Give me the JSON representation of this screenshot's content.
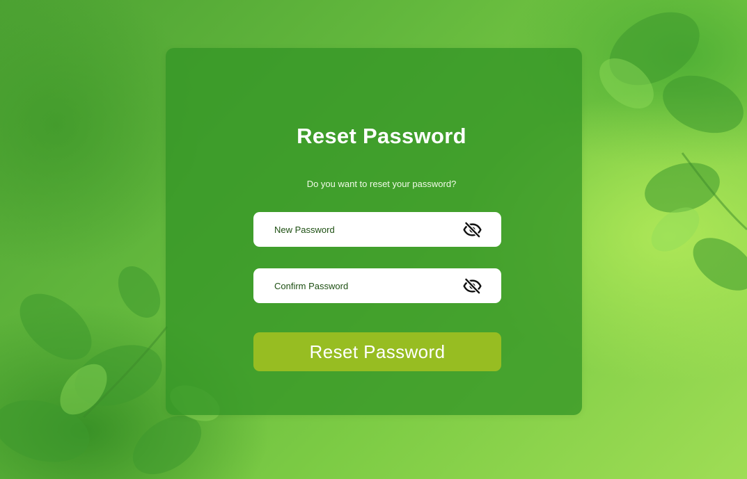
{
  "page": {
    "heading": "Reset Password",
    "subheading": "Do you want to reset your password?"
  },
  "form": {
    "new_password": {
      "value": "",
      "placeholder": "New Password",
      "toggle_icon": "eye-slash-icon"
    },
    "confirm_password": {
      "value": "",
      "placeholder": "Confirm Password",
      "toggle_icon": "eye-slash-icon"
    },
    "submit_label": "Reset Password"
  },
  "colors": {
    "card": "#3a9a2a",
    "button": "#97bd22",
    "input_text": "#1d4f12",
    "white": "#ffffff"
  }
}
